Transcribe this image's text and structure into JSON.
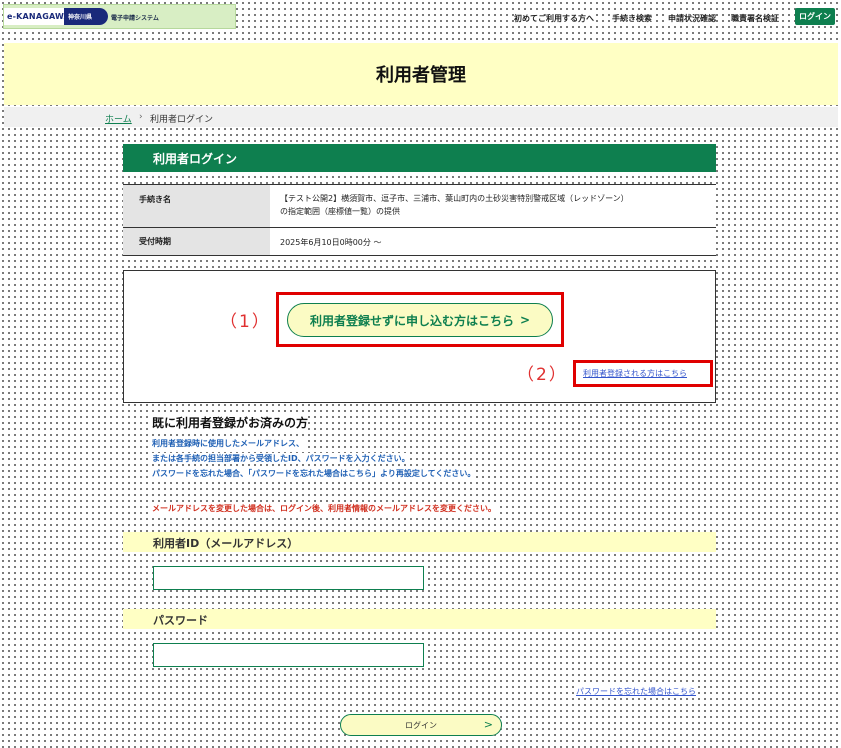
{
  "header": {
    "logo_text": "e-KANAGAWA",
    "logo_pref": "神奈川県",
    "logo_system": "電子申請システム",
    "nav": [
      "初めてご利用する方へ",
      "手続き検索",
      "申請状況確認",
      "職責署名検証"
    ],
    "login_label": "ログイン"
  },
  "page": {
    "title": "利用者管理"
  },
  "breadcrumb": {
    "home": "ホーム",
    "separator": "›",
    "current": "利用者ログイン"
  },
  "section": {
    "heading": "利用者ログイン"
  },
  "procedure": {
    "name_label": "手続き名",
    "name_line1": "【テスト公開2】横須賀市、逗子市、三浦市、葉山町内の土砂災害特別警戒区域（レッドゾーン）",
    "name_line2": "の指定範囲（座標値一覧）の提供",
    "period_label": "受付時期",
    "period_value": "2025年6月10日0時00分 〜"
  },
  "choices": {
    "no_register_label": "利用者登録せずに申し込む方はこちら",
    "no_register_chevron": ">",
    "register_link": "利用者登録される方はこちら",
    "marker_1": "（1）",
    "marker_2": "（2）"
  },
  "login_form": {
    "heading": "既に利用者登録がお済みの方",
    "note_1": "利用者登録時に使用したメールアドレス、",
    "note_2": "または各手続の担当部署から受領したID、パスワードを入力ください。",
    "note_3": "パスワードを忘れた場合、「パスワードを忘れた場合はこちら」より再設定してください。",
    "warning": "メールアドレスを変更した場合は、ログイン後、利用者情報のメールアドレスを変更ください。",
    "userid_label": "利用者ID（メールアドレス）",
    "userid_value": "",
    "password_label": "パスワード",
    "password_value": "",
    "forgot_link": "パスワードを忘れた場合はこちら",
    "submit_label": "ログイン",
    "submit_chevron": ">"
  },
  "colors": {
    "brand_green": "#0e7f4f",
    "highlight_yellow": "#ffffc4",
    "annotation_red": "#e00000",
    "note_blue": "#1e5fb4",
    "warning_red": "#d03020"
  }
}
